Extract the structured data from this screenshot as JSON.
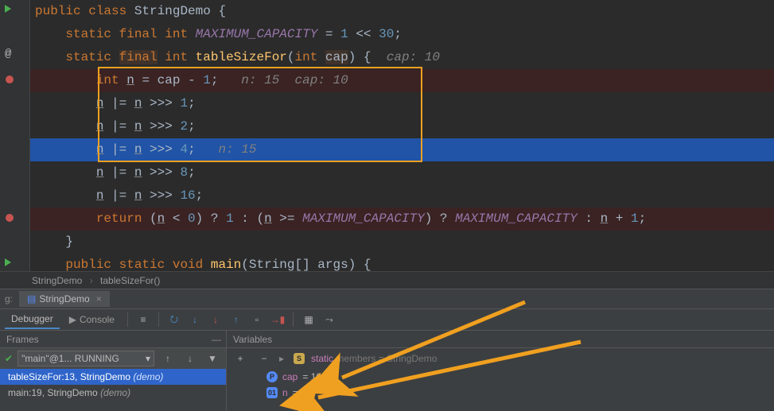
{
  "code": {
    "class_decl": {
      "public": "public",
      "class": "class",
      "name": "StringDemo",
      "brace": " {"
    },
    "line2": {
      "indent": "    ",
      "static": "static",
      "final": "final",
      "int": "int",
      "const": "MAXIMUM_CAPACITY",
      "op": " = ",
      "val": "1",
      "shift": " << ",
      "val2": "30",
      "semi": ";"
    },
    "line3": {
      "indent": "    ",
      "static": "static",
      "final": "final",
      "int": "int",
      "method": "tableSizeFor",
      "open": "(",
      "ptype": "int ",
      "param": "cap",
      "close": ") {",
      "ann": "  cap: 10"
    },
    "line4": {
      "indent": "        ",
      "int": "int",
      "n": "n",
      "eq": " = ",
      "cap": "cap",
      "minus": " - ",
      "one": "1",
      "semi": ";",
      "ann": "   n: 15  cap: 10"
    },
    "line5": {
      "indent": "        ",
      "n": "n",
      "op": " |= ",
      "n2": "n",
      "shift": " >>> ",
      "num": "1",
      "semi": ";"
    },
    "line6": {
      "indent": "        ",
      "n": "n",
      "op": " |= ",
      "n2": "n",
      "shift": " >>> ",
      "num": "2",
      "semi": ";"
    },
    "line7": {
      "indent": "        ",
      "n": "n",
      "op": " |= ",
      "n2": "n",
      "shift": " >>> ",
      "num": "4",
      "semi": ";",
      "ann": "   n: 15"
    },
    "line8": {
      "indent": "        ",
      "n": "n",
      "op": " |= ",
      "n2": "n",
      "shift": " >>> ",
      "num": "8",
      "semi": ";"
    },
    "line9": {
      "indent": "        ",
      "n": "n",
      "op": " |= ",
      "n2": "n",
      "shift": " >>> ",
      "num": "16",
      "semi": ";"
    },
    "line10": {
      "indent": "        ",
      "return": "return",
      "open": " (",
      "n": "n",
      "lt": " < ",
      "zero": "0",
      "close": ") ? ",
      "one": "1",
      "colon": " : (",
      "n2": "n",
      "gte": " >= ",
      "max": "MAXIMUM_CAPACITY",
      "close2": ") ? ",
      "max2": "MAXIMUM_CAPACITY",
      "colon2": " : ",
      "n3": "n",
      "plus": " + ",
      "one2": "1",
      "semi": ";"
    },
    "line11": {
      "indent": "    ",
      "brace": "}"
    },
    "line12": {
      "indent": "    ",
      "public": "public",
      "static": "static",
      "void": "void",
      "main": "main",
      "open": "(",
      "string": "String",
      "arr": "[] ",
      "args": "args",
      "close": ") {"
    }
  },
  "breadcrumb": {
    "class": "StringDemo",
    "method": "tableSizeFor()"
  },
  "debug_tab_prefix": "g:",
  "debug_tab": "StringDemo",
  "debugger_label": "Debugger",
  "console_label": "Console",
  "frames_label": "Frames",
  "variables_label": "Variables",
  "thread": "\"main\"@1... RUNNING",
  "stack": [
    {
      "text": "tableSizeFor:13, StringDemo ",
      "pkg": "(demo)",
      "selected": true
    },
    {
      "text": "main:19, StringDemo ",
      "pkg": "(demo)",
      "selected": false
    }
  ],
  "vars": {
    "static_label": "static",
    "static_members": " members = StringDemo",
    "cap_name": "cap",
    "cap_val": " = 10",
    "n_name": "n",
    "n_val": " = 15"
  }
}
